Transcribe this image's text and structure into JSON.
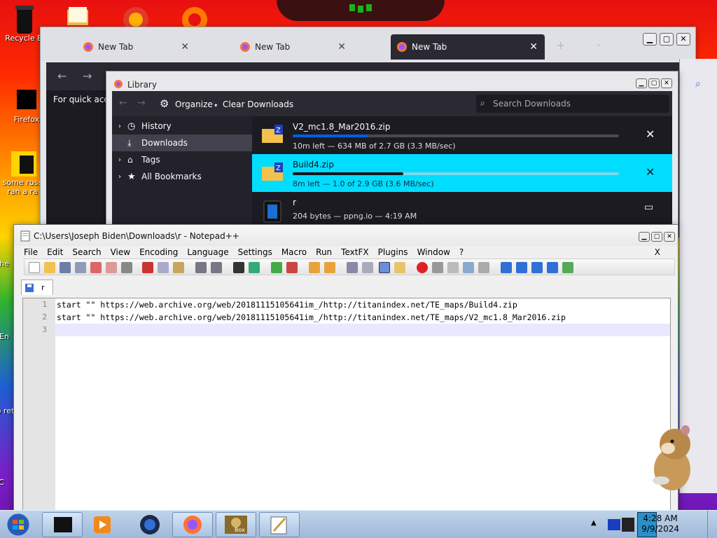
{
  "desktop": {
    "icons": [
      {
        "label": "Recycle B"
      },
      {
        "label": "Firefox"
      },
      {
        "label": "some russ ran a ra"
      },
      {
        "label": "the"
      },
      {
        "label": "En"
      },
      {
        "label": "no ret"
      },
      {
        "label": "C"
      }
    ]
  },
  "firefox": {
    "tabs": [
      {
        "title": "New Tab"
      },
      {
        "title": "New Tab"
      },
      {
        "title": "New Tab"
      }
    ],
    "bookmark_hint": "For quick acce"
  },
  "library": {
    "title": "Library",
    "toolbar": {
      "organize": "Organize",
      "clear_downloads": "Clear Downloads",
      "search_placeholder": "Search Downloads"
    },
    "tree": [
      {
        "label": "History"
      },
      {
        "label": "Downloads"
      },
      {
        "label": "Tags"
      },
      {
        "label": "All Bookmarks"
      }
    ],
    "downloads": [
      {
        "name": "V2_mc1.8_Mar2016.zip",
        "status": "10m left — 634 MB of 2.7 GB (3.3 MB/sec)",
        "progress": 0.23
      },
      {
        "name": "Build4.zip",
        "status": "8m left — 1.0 of 2.9 GB (3.6 MB/sec)",
        "progress": 0.34
      },
      {
        "name": "r",
        "status": "204 bytes — ppng.io — 4:19 AM",
        "progress": 1.0
      }
    ]
  },
  "notepad": {
    "title": "C:\\Users\\Joseph Biden\\Downloads\\r - Notepad++",
    "menu": [
      "File",
      "Edit",
      "Search",
      "View",
      "Encoding",
      "Language",
      "Settings",
      "Macro",
      "Run",
      "TextFX",
      "Plugins",
      "Window",
      "?"
    ],
    "menu_close": "X",
    "tab": "r",
    "lines": [
      {
        "n": "1",
        "text": "start \"\" https://web.archive.org/web/20181115105641im_/http://titanindex.net/TE_maps/Build4.zip"
      },
      {
        "n": "2",
        "text": "start \"\" https://web.archive.org/web/20181115105641im_/http://titanindex.net/TE_maps/V2_mc1.8_Mar2016.zip"
      },
      {
        "n": "3",
        "text": ""
      }
    ]
  },
  "taskbar": {
    "time": "4:28 AM",
    "date": "9/9/2024",
    "box_label": "Box"
  },
  "colors": {
    "ff_dark": "#2b2a33",
    "selection": "#00ddff",
    "progress": "#0060df"
  }
}
